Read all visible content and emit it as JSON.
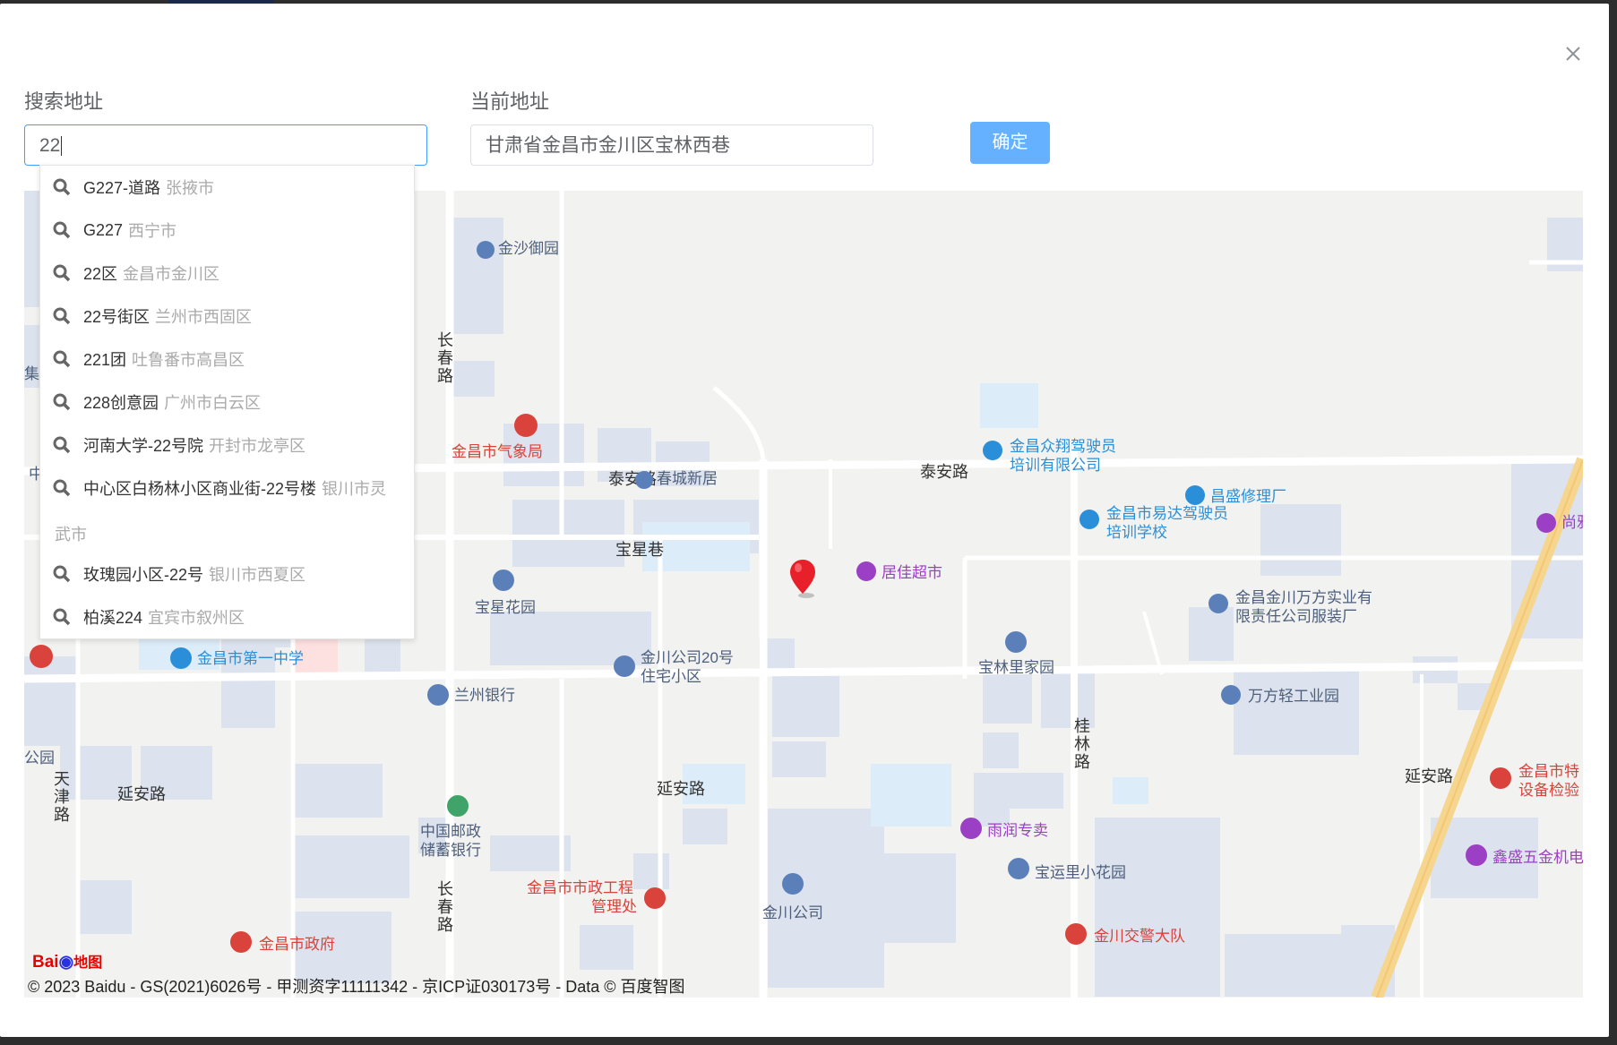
{
  "dialog": {
    "close_label": "×",
    "search": {
      "label": "搜索地址",
      "value": "22"
    },
    "current": {
      "label": "当前地址",
      "value": "甘肃省金昌市金川区宝林西巷"
    },
    "confirm_label": "确定"
  },
  "suggestions": [
    {
      "main": "G227-道路",
      "region": "张掖市"
    },
    {
      "main": "G227",
      "region": "西宁市"
    },
    {
      "main": "22区",
      "region": "金昌市金川区"
    },
    {
      "main": "22号街区",
      "region": "兰州市西固区"
    },
    {
      "main": "221团",
      "region": "吐鲁番市高昌区"
    },
    {
      "main": "228创意园",
      "region": "广州市白云区"
    },
    {
      "main": "河南大学-22号院",
      "region": "开封市龙亭区"
    },
    {
      "main": "中心区白杨林小区商业街-22号楼",
      "region": "银川市灵",
      "region_cont": "武市"
    },
    {
      "main": "玫瑰园小区-22号",
      "region": "银川市西夏区"
    },
    {
      "main": "柏溪224",
      "region": "宜宾市叙州区"
    }
  ],
  "map": {
    "roads": {
      "taian_w": "泰安路",
      "taian_e": "泰安路",
      "baoxing": "宝星巷",
      "yanan_w": "延安路",
      "yanan_c": "延安路",
      "yanan_e": "延安路",
      "changchun_n": "长春路",
      "changchun_s": "长春路",
      "tianjin": "天津路",
      "guilin": "桂林路"
    },
    "pois": {
      "jinsha": "金沙御园",
      "qixiang": "金昌市气象局",
      "chuncheng": "春城新居",
      "zhongxiang1": "金昌众翔驾驶员",
      "zhongxiang2": "培训有限公司",
      "changsheng": "昌盛修理厂",
      "yida1": "金昌市易达驾驶员",
      "yida2": "培训学校",
      "shang": "尚雅",
      "jujia": "居佳超市",
      "baoxinghy": "宝星花园",
      "wanfang1": "金昌金川万方实业有",
      "wanfang2": "限责任公司服装厂",
      "yizhong": "金昌市第一中学",
      "jc20_1": "金川公司20号",
      "jc20_2": "住宅小区",
      "baolin": "宝林里家园",
      "lanzhoubank": "兰州银行",
      "wanfangqg": "万方轻工业园",
      "tezhong1": "金昌市特",
      "tezhong2": "设备检验",
      "yourun": "雨润专卖",
      "youzheng1": "中国邮政",
      "youzheng2": "储蓄银行",
      "xinsheng": "鑫盛五金机电",
      "baoyun": "宝运里小花园",
      "shizheng1": "金昌市市政工程",
      "shizheng2": "管理处",
      "jcgs": "金川公司",
      "zhengfu": "金昌市政府",
      "jiaojing": "金川交警大队",
      "gongyuan": "公园",
      "ji": "集",
      "zhong": "中"
    },
    "logo": "Bai 地图",
    "copyright": "© 2023 Baidu - GS(2021)6026号 - 甲测资字11111342 - 京ICP证030173号 - Data © 百度智图"
  },
  "colors": {
    "accent": "#409eff",
    "button": "#66b1ff",
    "poi_blue": "#2a8fd8",
    "poi_red": "#d9433b",
    "poi_purple": "#9b3fc4",
    "building": "#dde3ee",
    "water": "#dcecf8",
    "road_yellow": "#f6d58e"
  }
}
